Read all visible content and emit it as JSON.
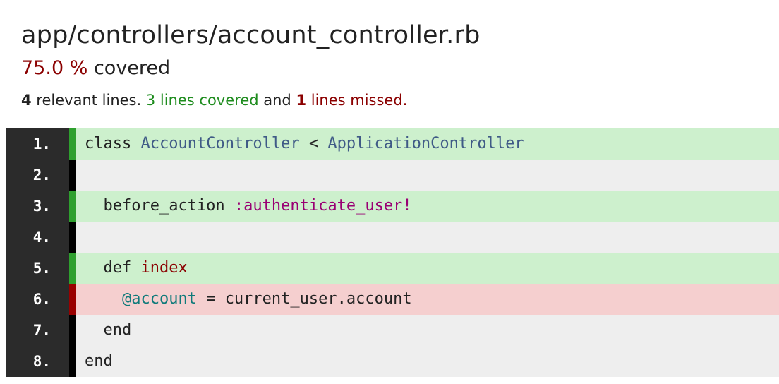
{
  "header": {
    "file_path": "app/controllers/account_controller.rb",
    "percent": "75.0 %",
    "covered_word": "covered",
    "relevant_count": "4",
    "relevant_text": " relevant lines. ",
    "covered_text": "3 lines covered",
    "and_text": " and ",
    "missed_count": "1",
    "missed_text": " lines missed."
  },
  "colors": {
    "covered_bg": "#cdf0cd",
    "missed_bg": "#f5cfcf",
    "never_bg": "#eeeeee",
    "covered_marker": "#2ea02e",
    "missed_marker": "#990000",
    "gutter_bg": "#2b2b2b"
  },
  "lines": [
    {
      "number": "1.",
      "status": "covered",
      "tokens": [
        {
          "t": "class ",
          "c": ""
        },
        {
          "t": "AccountController",
          "c": "tok-class"
        },
        {
          "t": " < ",
          "c": ""
        },
        {
          "t": "ApplicationController",
          "c": "tok-class"
        }
      ]
    },
    {
      "number": "2.",
      "status": "never",
      "tokens": []
    },
    {
      "number": "3.",
      "status": "covered",
      "tokens": [
        {
          "t": "  before_action ",
          "c": ""
        },
        {
          "t": ":authenticate_user!",
          "c": "tok-symbol"
        }
      ]
    },
    {
      "number": "4.",
      "status": "never",
      "tokens": []
    },
    {
      "number": "5.",
      "status": "covered",
      "tokens": [
        {
          "t": "  def ",
          "c": ""
        },
        {
          "t": "index",
          "c": "tok-method"
        }
      ]
    },
    {
      "number": "6.",
      "status": "missed",
      "tokens": [
        {
          "t": "    ",
          "c": ""
        },
        {
          "t": "@account",
          "c": "tok-ivar"
        },
        {
          "t": " = current_user.account",
          "c": ""
        }
      ]
    },
    {
      "number": "7.",
      "status": "never",
      "tokens": [
        {
          "t": "  end",
          "c": ""
        }
      ]
    },
    {
      "number": "8.",
      "status": "never",
      "tokens": [
        {
          "t": "end",
          "c": ""
        }
      ]
    }
  ]
}
